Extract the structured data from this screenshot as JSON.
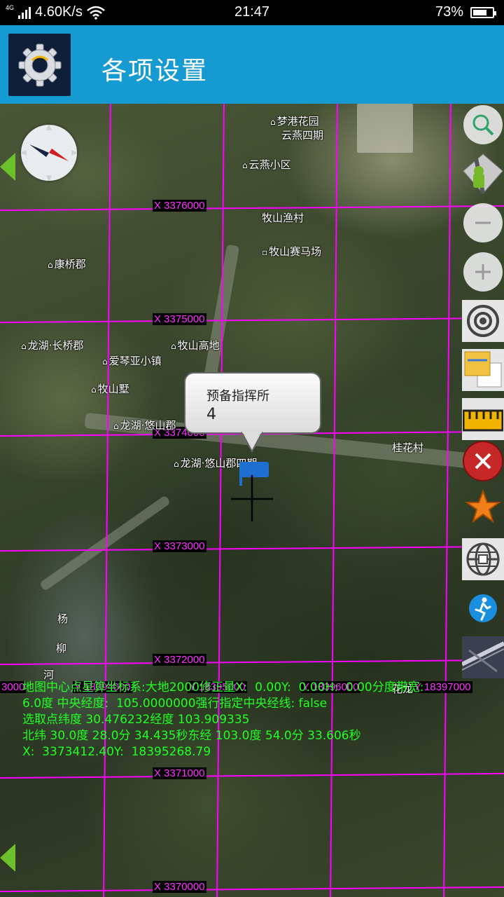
{
  "status_bar": {
    "network_type": "4G",
    "speed": "4.60K/s",
    "time": "21:47",
    "battery_percent": "73%",
    "battery_level": 0.73
  },
  "app_bar": {
    "icon": "gear-icon",
    "title": "各项设置"
  },
  "map": {
    "grid_x_labels": [
      "X 3376000",
      "X 3375000",
      "X 3374000",
      "X 3373000",
      "X 3372000",
      "X 3371000",
      "X 3370000"
    ],
    "grid_y_label_partial": [
      "3000",
      "Y 18394000",
      "Y 18395000",
      "Y 18396000",
      "Y 18397000"
    ],
    "pois": [
      "梦港花园",
      "云燕四期",
      "云燕小区",
      "牧山渔村",
      "牧山赛马场",
      "康桥郡",
      "龙湖·长桥郡",
      "牧山高地",
      "爱琴亚小镇",
      "牧山墅",
      "龙湖·悠山郡",
      "龙湖·悠山郡四期",
      "桂花村",
      "杨",
      "柳",
      "河",
      "花龙"
    ],
    "callout": {
      "title": "预备指挥所",
      "value": "4"
    },
    "info_lines": [
      "地图中心点星算坐标系:大地2000修正量X:  0.00Y:  0.00H:  0.00分度带宽:",
      "6.0度 中央经度:  105.0000000强行指定中央经线: false",
      "选取点纬度 30.476232经度 103.909335",
      "北纬 30.0度 28.0分 34.435秒东经 103.0度 54.0分 33.606秒",
      "X:  3373412.40Y:  18395268.79"
    ]
  },
  "tools": [
    "search-icon",
    "route-icon",
    "zoom-out-icon",
    "zoom-in-icon",
    "locate-icon",
    "layers-icon",
    "ruler-icon",
    "close-icon",
    "favorite-star-icon",
    "globe-grid-icon",
    "walk-icon",
    "satellite-image-icon"
  ],
  "colors": {
    "app_bar": "#159ad1",
    "grid": "#ff00ff",
    "info_text": "#22ff22",
    "marker_flag": "#1f6fd1"
  }
}
